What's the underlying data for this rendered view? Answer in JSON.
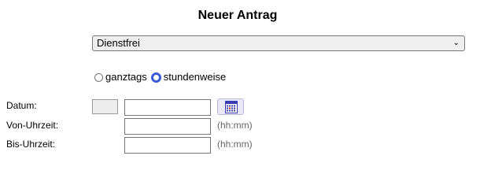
{
  "form": {
    "title": "Neuer Antrag",
    "type_select": {
      "selected": "Dienstfrei"
    },
    "mode_options": [
      {
        "label": "ganztags",
        "checked": false
      },
      {
        "label": "stundenweise",
        "checked": true
      }
    ],
    "fields": {
      "date_label": "Datum:",
      "from_label": "Von-Uhrzeit:",
      "to_label": "Bis-Uhrzeit:",
      "date_value": "",
      "from_value": "",
      "to_value": "",
      "from_hint": "(hh:mm)",
      "to_hint": "(hh:mm)"
    },
    "icons": {
      "calendar": "calendar-icon",
      "select_arrow": "chevron-down-icon"
    },
    "colors": {
      "radio_checked": "#3b5bdb",
      "calendar_accent": "#3b3bb0"
    }
  }
}
